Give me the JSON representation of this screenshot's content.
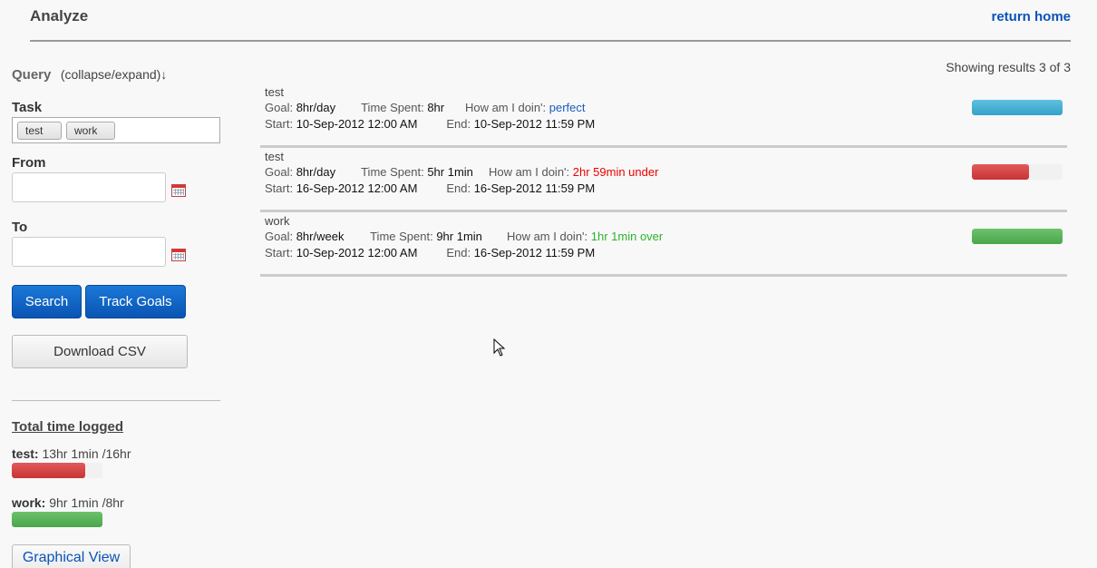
{
  "header": {
    "title": "Analyze",
    "return_home": "return home"
  },
  "query": {
    "title": "Query",
    "toggle": "(collapse/expand)↓",
    "task_label": "Task",
    "tags": [
      "test",
      "work"
    ],
    "from_label": "From",
    "from_value": "",
    "to_label": "To",
    "to_value": "",
    "search_label": "Search",
    "track_goals_label": "Track Goals",
    "download_label": "Download CSV"
  },
  "totals": {
    "title": "Total time logged",
    "items": [
      {
        "name": "test:",
        "value": "13hr 1min /16hr",
        "fraction": 0.81,
        "color": "#d44444"
      },
      {
        "name": "work:",
        "value": "9hr 1min /8hr",
        "fraction": 1.0,
        "color": "#58b358"
      }
    ],
    "graphical_view": "Graphical View"
  },
  "results": {
    "showing": "Showing results 3 of 3",
    "goal_label": "Goal:",
    "spent_label": "Time Spent:",
    "doin_label": "How am I doin':",
    "start_label": "Start:",
    "end_label": "End:",
    "items": [
      {
        "name": "test",
        "goal": "8hr/day",
        "spent": "8hr",
        "status": "perfect",
        "start": "10-Sep-2012 12:00 AM",
        "end": "10-Sep-2012 11:59 PM",
        "fraction": 1.0,
        "color": "#45afd4"
      },
      {
        "name": "test",
        "goal": "8hr/day",
        "spent": "5hr 1min",
        "status": "2hr 59min under",
        "start": "16-Sep-2012 12:00 AM",
        "end": "16-Sep-2012 11:59 PM",
        "fraction": 0.63,
        "color": "#d44444"
      },
      {
        "name": "work",
        "goal": "8hr/week",
        "spent": "9hr 1min",
        "status": "1hr 1min over",
        "start": "10-Sep-2012 12:00 AM",
        "end": "16-Sep-2012 11:59 PM",
        "fraction": 1.0,
        "color": "#58b358"
      }
    ]
  }
}
